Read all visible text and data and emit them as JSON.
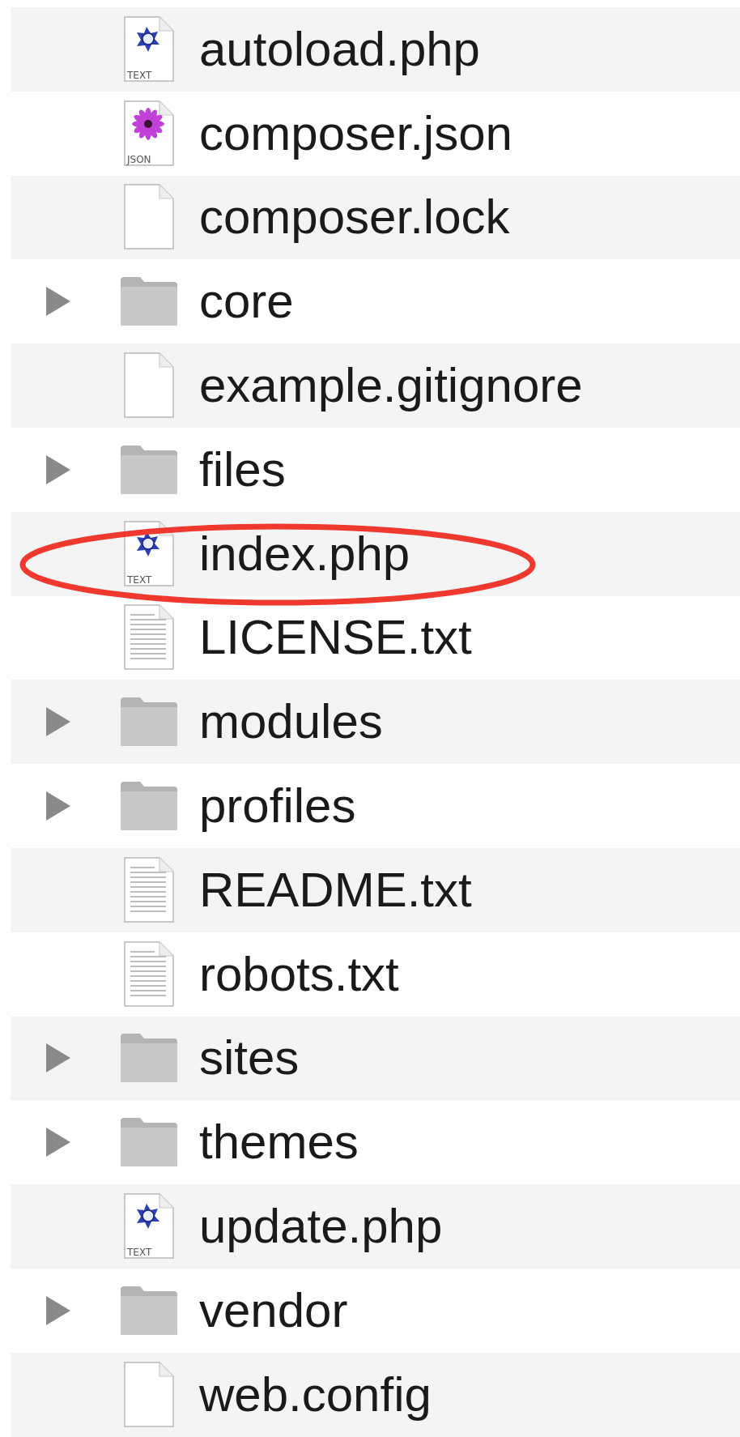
{
  "files": [
    {
      "name": "autoload.php",
      "kind": "php",
      "badge": "TEXT",
      "folder": false,
      "highlighted": false
    },
    {
      "name": "composer.json",
      "kind": "json",
      "badge": "JSON",
      "folder": false,
      "highlighted": false
    },
    {
      "name": "composer.lock",
      "kind": "blank",
      "folder": false,
      "highlighted": false
    },
    {
      "name": "core",
      "kind": "folder",
      "folder": true,
      "expanded": false,
      "highlighted": false
    },
    {
      "name": "example.gitignore",
      "kind": "blank",
      "folder": false,
      "highlighted": false
    },
    {
      "name": "files",
      "kind": "folder",
      "folder": true,
      "expanded": false,
      "highlighted": false
    },
    {
      "name": "index.php",
      "kind": "php",
      "badge": "TEXT",
      "folder": false,
      "highlighted": true
    },
    {
      "name": "LICENSE.txt",
      "kind": "text",
      "folder": false,
      "highlighted": false
    },
    {
      "name": "modules",
      "kind": "folder",
      "folder": true,
      "expanded": false,
      "highlighted": false
    },
    {
      "name": "profiles",
      "kind": "folder",
      "folder": true,
      "expanded": false,
      "highlighted": false
    },
    {
      "name": "README.txt",
      "kind": "text",
      "folder": false,
      "highlighted": false
    },
    {
      "name": "robots.txt",
      "kind": "text",
      "folder": false,
      "highlighted": false
    },
    {
      "name": "sites",
      "kind": "folder",
      "folder": true,
      "expanded": false,
      "highlighted": false
    },
    {
      "name": "themes",
      "kind": "folder",
      "folder": true,
      "expanded": false,
      "highlighted": false
    },
    {
      "name": "update.php",
      "kind": "php",
      "badge": "TEXT",
      "folder": false,
      "highlighted": false
    },
    {
      "name": "vendor",
      "kind": "folder",
      "folder": true,
      "expanded": false,
      "highlighted": false
    },
    {
      "name": "web.config",
      "kind": "blank",
      "folder": false,
      "highlighted": false
    }
  ]
}
